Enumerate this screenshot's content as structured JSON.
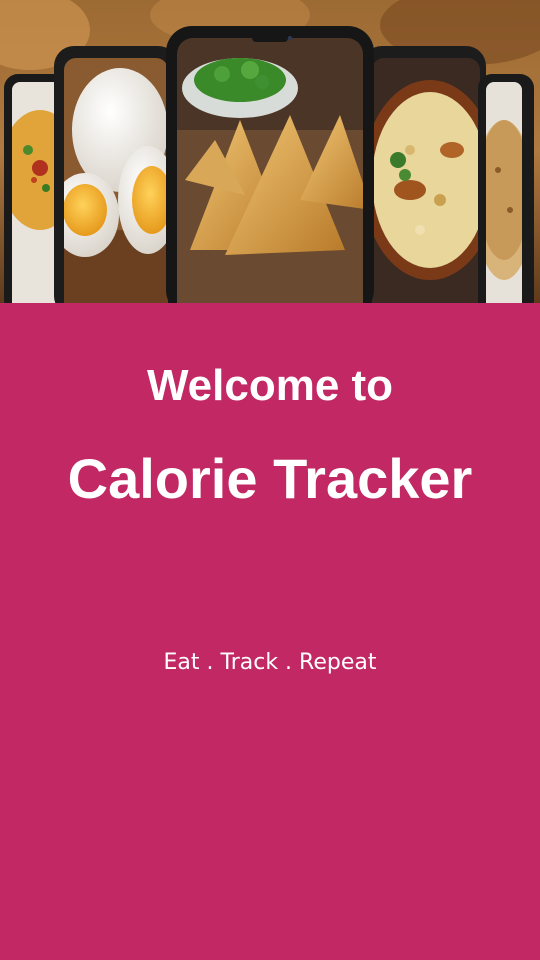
{
  "hero": {
    "photos": [
      {
        "icon": "dal-bowl-photo"
      },
      {
        "icon": "boiled-eggs-photo"
      },
      {
        "icon": "samosa-photo"
      },
      {
        "icon": "biryani-photo"
      },
      {
        "icon": "roti-photo"
      }
    ]
  },
  "welcome": {
    "line1": "Welcome to",
    "line2": "Calorie Tracker"
  },
  "tagline": "Eat . Track . Repeat",
  "colors": {
    "background": "#c12864",
    "text": "#ffffff"
  }
}
